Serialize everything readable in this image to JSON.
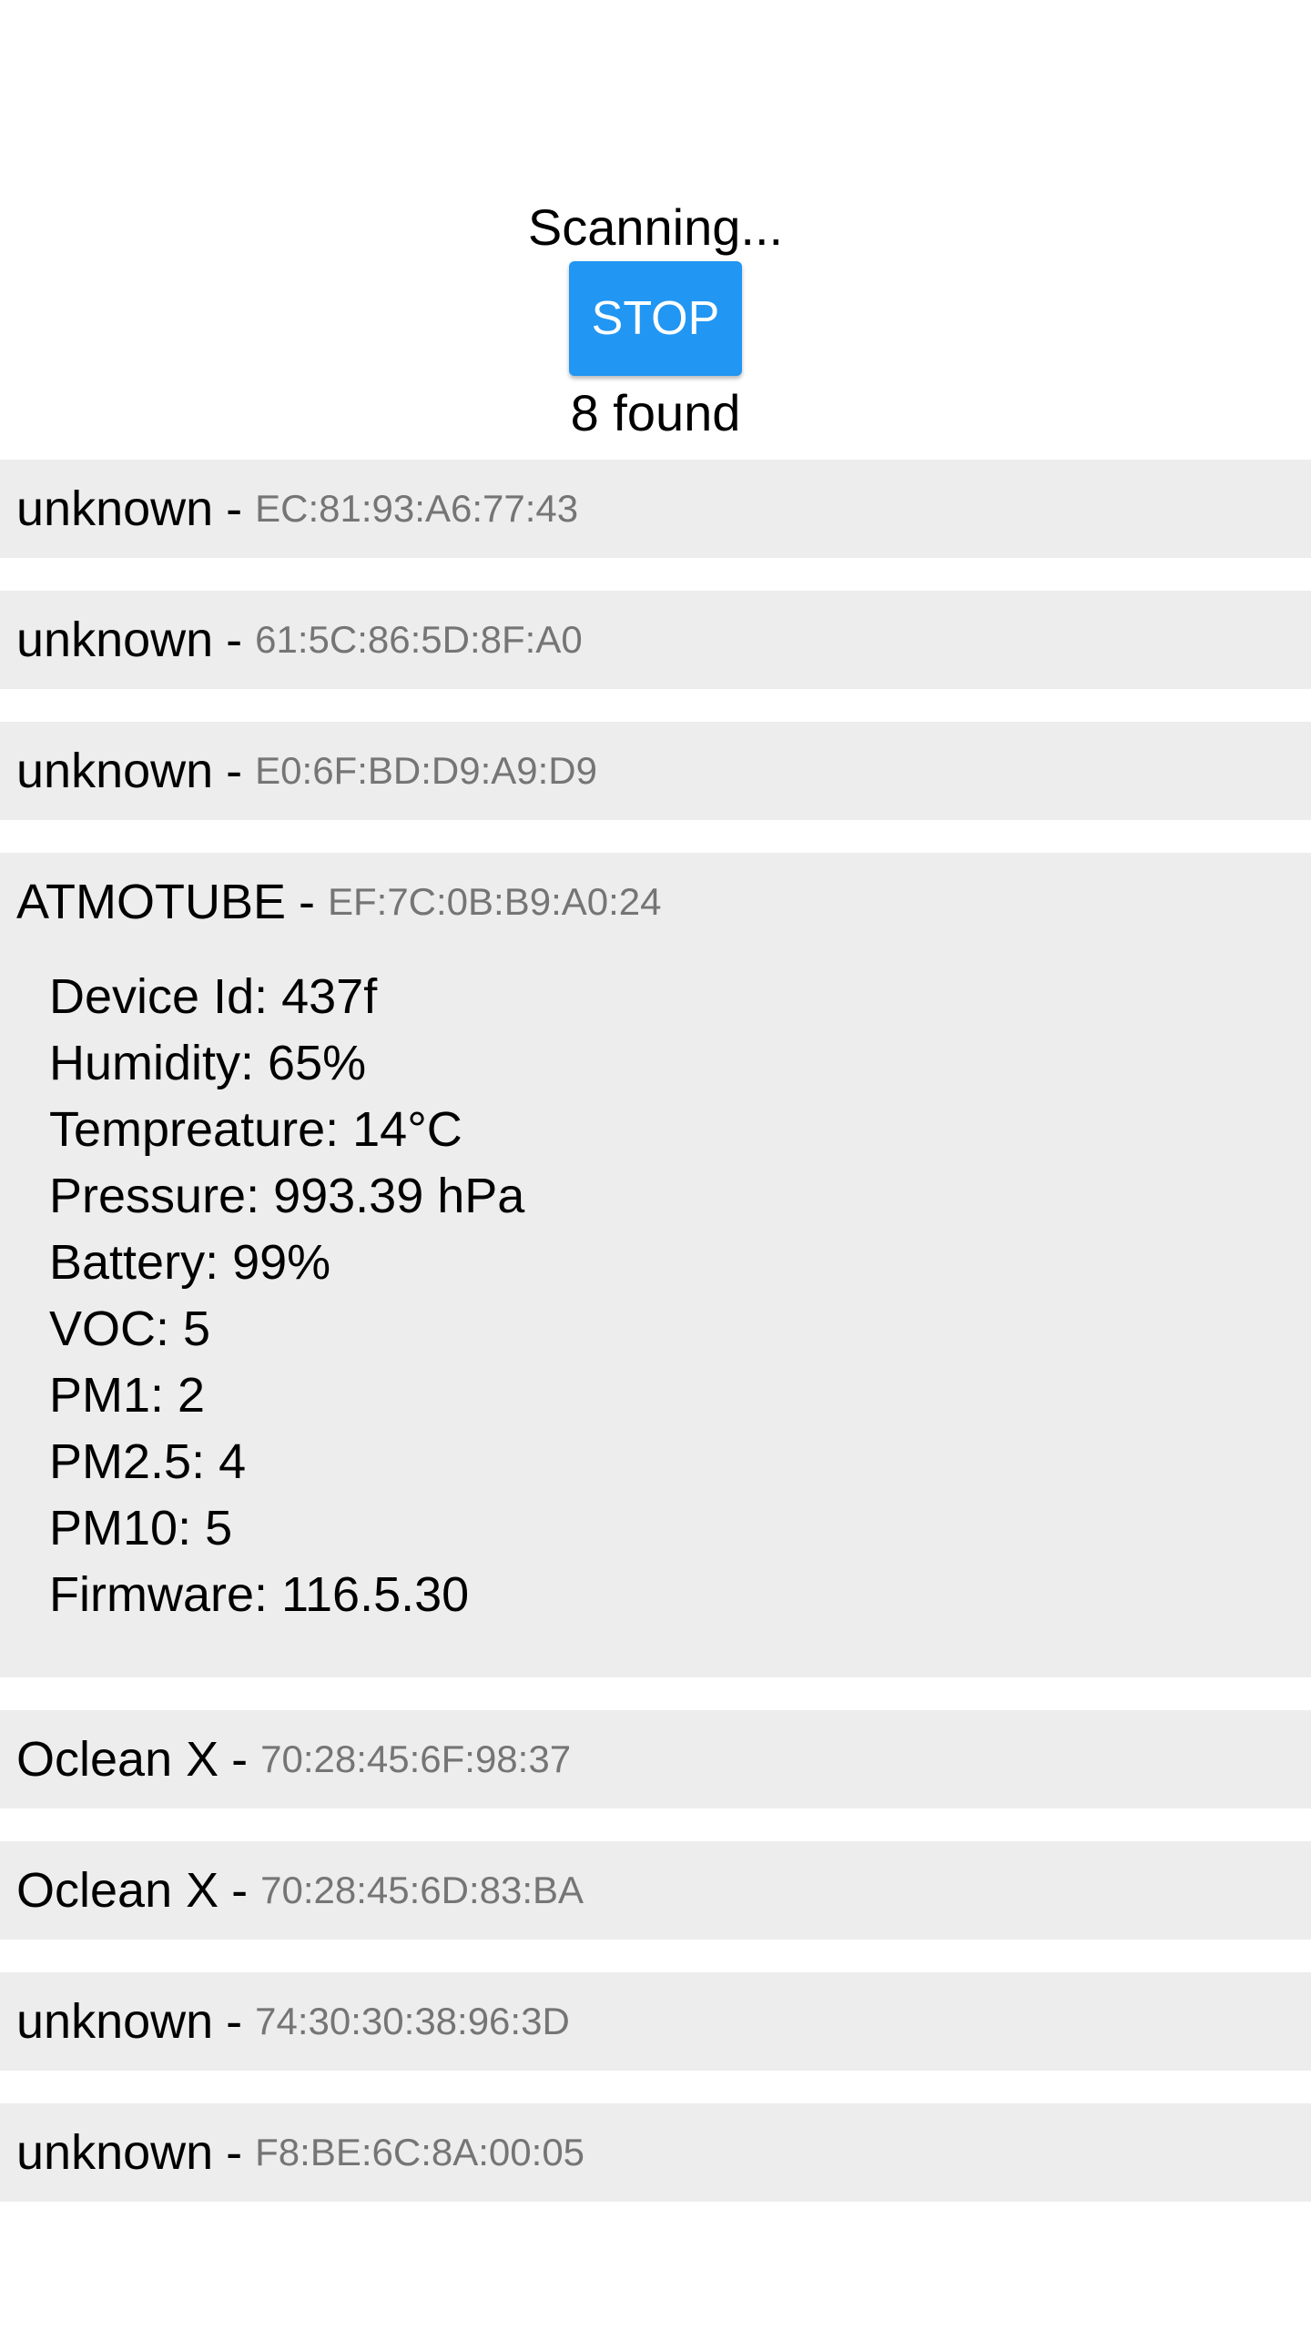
{
  "scan": {
    "status": "Scanning...",
    "stop_label": "STOP",
    "found": "8 found"
  },
  "devices": [
    {
      "name": "unknown",
      "mac": "EC:81:93:A6:77:43"
    },
    {
      "name": "unknown",
      "mac": "61:5C:86:5D:8F:A0"
    },
    {
      "name": "unknown",
      "mac": "E0:6F:BD:D9:A9:D9"
    },
    {
      "name": "ATMOTUBE",
      "mac": "EF:7C:0B:B9:A0:24",
      "details": [
        "Device Id: 437f",
        "Humidity: 65%",
        "Tempreature: 14°C",
        "Pressure: 993.39 hPa",
        "Battery: 99%",
        "VOC: 5",
        "PM1: 2",
        "PM2.5: 4",
        "PM10: 5",
        "Firmware: 116.5.30"
      ]
    },
    {
      "name": "Oclean X",
      "mac": "70:28:45:6F:98:37"
    },
    {
      "name": "Oclean X",
      "mac": "70:28:45:6D:83:BA"
    },
    {
      "name": "unknown",
      "mac": "74:30:30:38:96:3D"
    },
    {
      "name": "unknown",
      "mac": "F8:BE:6C:8A:00:05"
    }
  ],
  "colors": {
    "accent": "#2196f3",
    "row_background": "#ededed",
    "mac_text": "#757575"
  }
}
